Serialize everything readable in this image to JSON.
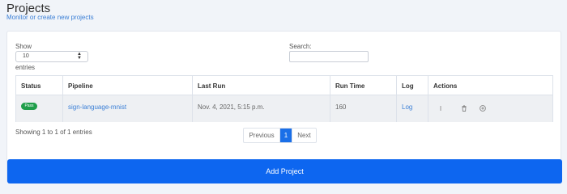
{
  "header": {
    "title": "Projects",
    "subtitle": "Monitor or create new projects"
  },
  "controls": {
    "show_label": "Show",
    "entries_value": "10",
    "entries_label": "entries",
    "search_label": "Search:"
  },
  "table": {
    "columns": [
      "Status",
      "Pipeline",
      "Last Run",
      "Run Time",
      "Log",
      "Actions"
    ],
    "rows": [
      {
        "status": "Pass",
        "pipeline": "sign-language-mnist",
        "last_run": "Nov. 4, 2021, 5:15 p.m.",
        "run_time": "160",
        "log": "Log",
        "action_icons": [
          "info-icon",
          "trash-icon",
          "add-circle-icon"
        ]
      }
    ]
  },
  "footer": {
    "showing": "Showing 1 to 1 of 1 entries",
    "pagination": {
      "previous": "Previous",
      "current": "1",
      "next": "Next"
    }
  },
  "add_button": "Add Project",
  "colors": {
    "accent": "#0d66f0",
    "link": "#3b7fd6",
    "pass_badge": "#1f9e4a",
    "background": "#f1f4f9"
  }
}
